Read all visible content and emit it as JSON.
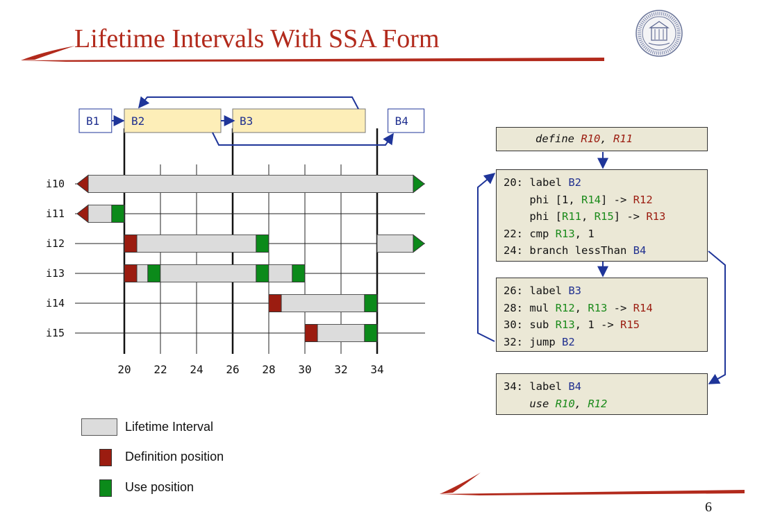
{
  "slide": {
    "title": "Lifetime Intervals With SSA Form",
    "page_number": "6",
    "logo_icon": "university-of-california-seal-icon"
  },
  "colors": {
    "title": "#b22a1c",
    "interval": "#dcdcdc",
    "definition": "#9b1c10",
    "use": "#0b8a1a",
    "block_fill": "#fdeeb8",
    "flow_arrow": "#1f3599",
    "code_bg": "#ebe8d6"
  },
  "blocks": [
    {
      "id": "B1",
      "label": "B1",
      "start": 17.5,
      "end": 19.3,
      "highlight": false
    },
    {
      "id": "B2",
      "label": "B2",
      "start": 20,
      "end": 26,
      "highlight": true
    },
    {
      "id": "B3",
      "label": "B3",
      "start": 26,
      "end": 34,
      "highlight": true
    },
    {
      "id": "B4",
      "label": "B4",
      "start": 34.6,
      "end": 36.6,
      "highlight": false
    }
  ],
  "intervals": [
    {
      "name": "i10",
      "ranges": [
        [
          18,
          36
        ]
      ],
      "defs": [],
      "uses": [],
      "arrow_left": true,
      "arrow_right": true
    },
    {
      "name": "i11",
      "ranges": [
        [
          18,
          20
        ]
      ],
      "defs": [],
      "uses": [
        19.3
      ],
      "arrow_left": true,
      "arrow_right": false
    },
    {
      "name": "i12",
      "ranges": [
        [
          20,
          28
        ],
        [
          34,
          36
        ]
      ],
      "defs": [
        20
      ],
      "uses": [
        27.3
      ],
      "arrow_left": false,
      "arrow_right": true
    },
    {
      "name": "i13",
      "ranges": [
        [
          20,
          30
        ]
      ],
      "defs": [
        20
      ],
      "uses": [
        21.3,
        27.3,
        29.3
      ],
      "arrow_left": false,
      "arrow_right": false
    },
    {
      "name": "i14",
      "ranges": [
        [
          28,
          34
        ]
      ],
      "defs": [
        28
      ],
      "uses": [
        33.3
      ],
      "arrow_left": false,
      "arrow_right": false
    },
    {
      "name": "i15",
      "ranges": [
        [
          30,
          34
        ]
      ],
      "defs": [
        30
      ],
      "uses": [
        33.3
      ],
      "arrow_left": false,
      "arrow_right": false
    }
  ],
  "axis": {
    "ticks": [
      "20",
      "22",
      "24",
      "26",
      "28",
      "30",
      "32",
      "34"
    ],
    "block_boundaries": [
      20,
      26,
      34
    ]
  },
  "legend": {
    "interval_label": "Lifetime Interval",
    "definition_label": "Definition position",
    "use_label": "Use position"
  },
  "code": {
    "define_box": [
      [
        {
          "t": "define ",
          "c": "",
          "i": true
        },
        {
          "t": "R10",
          "c": "red",
          "i": true
        },
        {
          "t": ", ",
          "c": "",
          "i": true
        },
        {
          "t": "R11",
          "c": "red",
          "i": true
        }
      ]
    ],
    "b2_box": [
      [
        {
          "t": "20: label ",
          "c": ""
        },
        {
          "t": "B2",
          "c": "blue"
        }
      ],
      [
        {
          "t": "    phi [1, ",
          "c": ""
        },
        {
          "t": "R14",
          "c": "green"
        },
        {
          "t": "] -> ",
          "c": ""
        },
        {
          "t": "R12",
          "c": "red"
        }
      ],
      [
        {
          "t": "    phi [",
          "c": ""
        },
        {
          "t": "R11",
          "c": "green"
        },
        {
          "t": ", ",
          "c": ""
        },
        {
          "t": "R15",
          "c": "green"
        },
        {
          "t": "] -> ",
          "c": ""
        },
        {
          "t": "R13",
          "c": "red"
        }
      ],
      [
        {
          "t": "22: cmp ",
          "c": ""
        },
        {
          "t": "R13",
          "c": "green"
        },
        {
          "t": ", 1",
          "c": ""
        }
      ],
      [
        {
          "t": "24: branch lessThan ",
          "c": ""
        },
        {
          "t": "B4",
          "c": "blue"
        }
      ]
    ],
    "b3_box": [
      [
        {
          "t": "26: label ",
          "c": ""
        },
        {
          "t": "B3",
          "c": "blue"
        }
      ],
      [
        {
          "t": "28: mul ",
          "c": ""
        },
        {
          "t": "R12",
          "c": "green"
        },
        {
          "t": ", ",
          "c": ""
        },
        {
          "t": "R13",
          "c": "green"
        },
        {
          "t": " -> ",
          "c": ""
        },
        {
          "t": "R14",
          "c": "red"
        }
      ],
      [
        {
          "t": "30: sub ",
          "c": ""
        },
        {
          "t": "R13",
          "c": "green"
        },
        {
          "t": ", 1 -> ",
          "c": ""
        },
        {
          "t": "R15",
          "c": "red"
        }
      ],
      [
        {
          "t": "32: jump ",
          "c": ""
        },
        {
          "t": "B2",
          "c": "blue"
        }
      ]
    ],
    "b4_box": [
      [
        {
          "t": "34: label ",
          "c": ""
        },
        {
          "t": "B4",
          "c": "blue"
        }
      ],
      [
        {
          "t": "    ",
          "c": ""
        },
        {
          "t": "use ",
          "c": "",
          "i": true
        },
        {
          "t": "R10",
          "c": "green",
          "i": true
        },
        {
          "t": ", ",
          "c": "",
          "i": true
        },
        {
          "t": "R12",
          "c": "green",
          "i": true
        }
      ]
    ]
  }
}
